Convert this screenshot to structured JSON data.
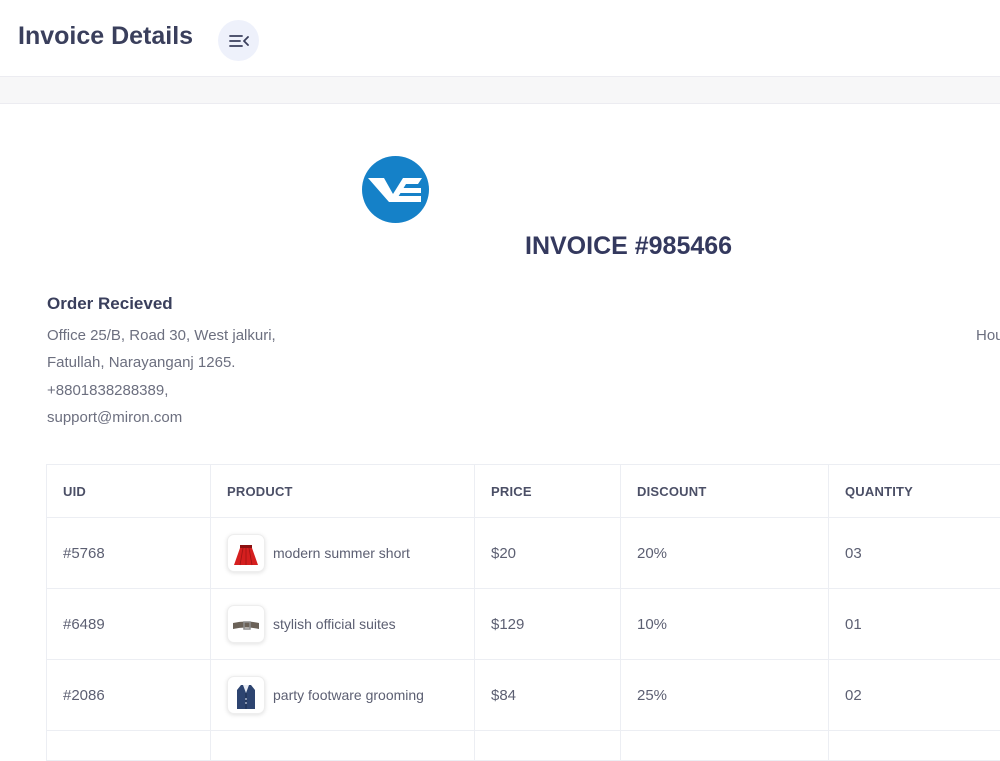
{
  "header": {
    "title": "Invoice Details",
    "menu_icon": "menu-collapse-icon"
  },
  "invoice": {
    "logo_icon": "company-logo",
    "brand_color": "#1581c8",
    "title": "INVOICE #985466"
  },
  "order": {
    "heading": "Order Recieved",
    "address_lines": [
      "Office 25/B, Road 30, West jalkuri,",
      "Fatullah, Narayanganj 1265.",
      "+8801838288389,",
      "support@miron.com"
    ],
    "right_column_text": "Hou"
  },
  "table": {
    "headers": [
      "UID",
      "PRODUCT",
      "PRICE",
      "DISCOUNT",
      "QUANTITY"
    ],
    "rows": [
      {
        "uid": "#5768",
        "product": "modern summer short",
        "price": "$20",
        "discount": "20%",
        "quantity": "03",
        "thumb_icon": "red-skirt-icon"
      },
      {
        "uid": "#6489",
        "product": "stylish official suites",
        "price": "$129",
        "discount": "10%",
        "quantity": "01",
        "thumb_icon": "belt-icon"
      },
      {
        "uid": "#2086",
        "product": "party footware grooming",
        "price": "$84",
        "discount": "25%",
        "quantity": "02",
        "thumb_icon": "blazer-icon"
      }
    ]
  }
}
